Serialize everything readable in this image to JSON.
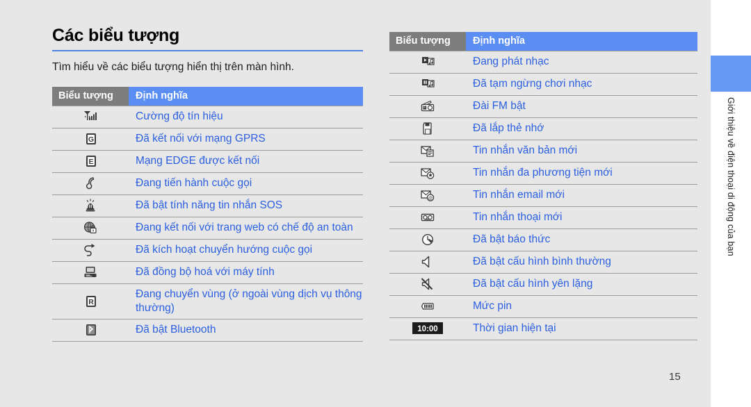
{
  "page": {
    "title": "Các biểu tượng",
    "intro": "Tìm hiểu về các biểu tượng hiển thị trên màn hình.",
    "number": "15",
    "accent_blue": "#5b8ef2",
    "header_gray": "#7d7d7d",
    "link_blue": "#2b5fe0",
    "background": "#e7e7e7"
  },
  "sidebar": {
    "tab_label": "",
    "vertical_label": "Giới thiệu về điện thoại di động của bạn"
  },
  "tables": [
    {
      "id": "left-table",
      "headers": {
        "icon": "Biểu tượng",
        "definition": "Định nghĩa"
      },
      "rows": [
        {
          "icon": "signal-strength-icon",
          "definition": "Cường độ tín hiệu"
        },
        {
          "icon": "gprs-connected-icon",
          "definition": "Đã kết nối với mạng GPRS"
        },
        {
          "icon": "edge-connected-icon",
          "definition": "Mạng EDGE được kết nối"
        },
        {
          "icon": "call-in-progress-icon",
          "definition": "Đang tiến hành cuộc gọi"
        },
        {
          "icon": "sos-message-icon",
          "definition": "Đã bật tính năng tin nhắn SOS"
        },
        {
          "icon": "secure-web-icon",
          "definition": "Đang kết nối với trang web có chế độ an toàn"
        },
        {
          "icon": "call-diverting-icon",
          "definition": "Đã kích hoạt chuyển hướng cuộc gọi"
        },
        {
          "icon": "pc-sync-icon",
          "definition": "Đã đồng bộ hoá với máy tính"
        },
        {
          "icon": "roaming-icon",
          "definition": "Đang chuyển vùng (ở ngoài vùng dịch vụ thông thường)"
        },
        {
          "icon": "bluetooth-icon",
          "definition": "Đã bật Bluetooth"
        }
      ]
    },
    {
      "id": "right-table",
      "headers": {
        "icon": "Biểu tượng",
        "definition": "Định nghĩa"
      },
      "rows": [
        {
          "icon": "music-playing-icon",
          "definition": "Đang phát nhạc"
        },
        {
          "icon": "music-paused-icon",
          "definition": "Đã tạm ngừng chơi nhạc"
        },
        {
          "icon": "fm-radio-on-icon",
          "definition": "Đài FM bật"
        },
        {
          "icon": "memory-card-icon",
          "definition": "Đã lắp thẻ nhớ"
        },
        {
          "icon": "new-text-message-icon",
          "definition": "Tin nhắn văn bản mới"
        },
        {
          "icon": "new-mms-icon",
          "definition": "Tin nhắn đa phương tiện mới"
        },
        {
          "icon": "new-email-icon",
          "definition": "Tin nhắn email mới"
        },
        {
          "icon": "new-voicemail-icon",
          "definition": "Tin nhắn thoại mới"
        },
        {
          "icon": "alarm-on-icon",
          "definition": "Đã bật báo thức"
        },
        {
          "icon": "normal-profile-icon",
          "definition": "Đã bật cấu hình bình thường"
        },
        {
          "icon": "silent-profile-icon",
          "definition": "Đã bật cấu hình yên lặng"
        },
        {
          "icon": "battery-level-icon",
          "definition": "Mức pin"
        },
        {
          "icon": "current-time-icon",
          "definition": "Thời gian hiện tại",
          "icon_text": "10:00"
        }
      ]
    }
  ]
}
